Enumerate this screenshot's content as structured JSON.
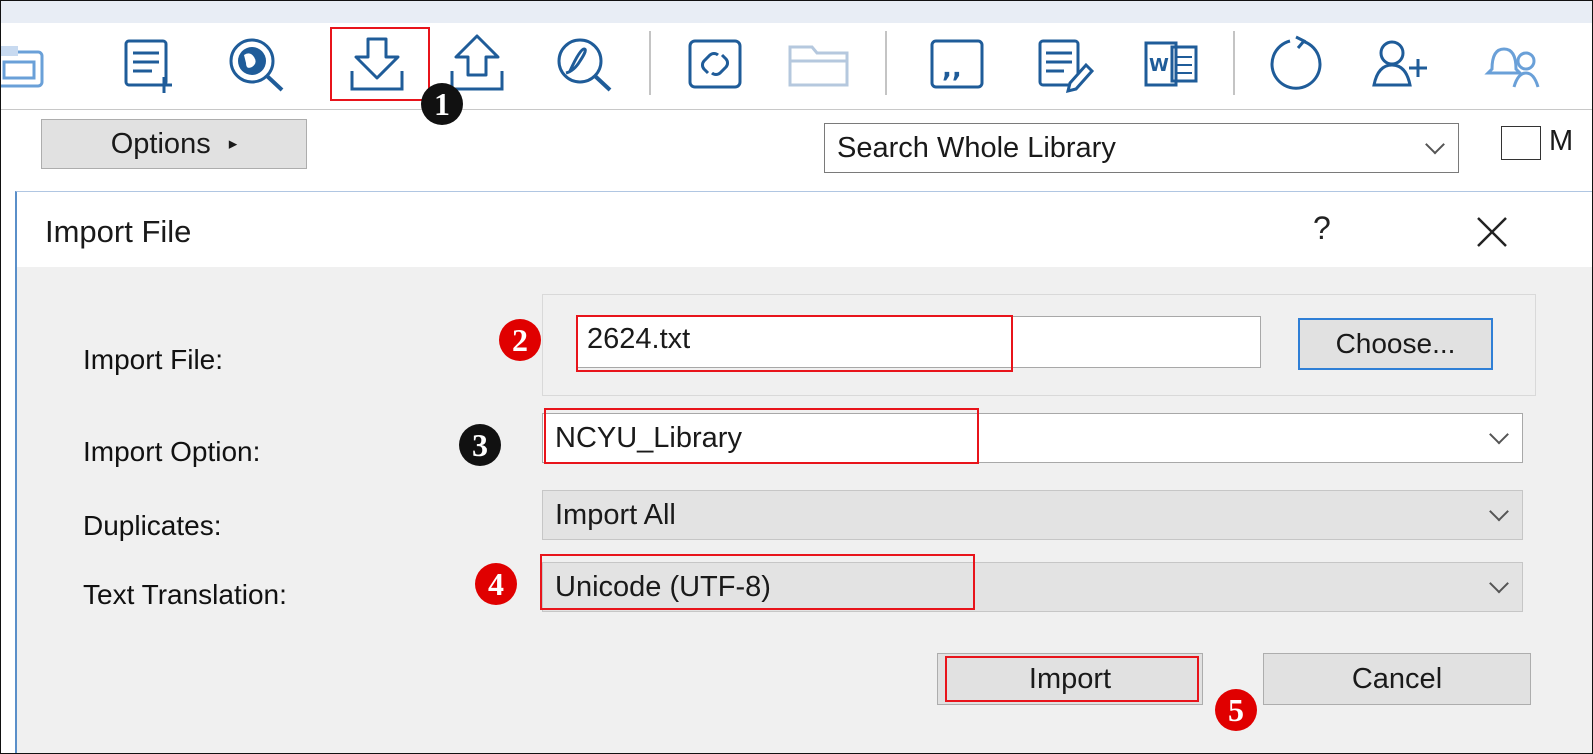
{
  "toolbar": {
    "icons": [
      "copy-to-library-icon",
      "new-reference-icon",
      "online-search-icon",
      "import-icon",
      "export-icon",
      "find-full-text-icon",
      "open-link-icon",
      "open-file-icon",
      "insert-citation-icon",
      "format-bibliography-icon",
      "return-to-word-icon",
      "sync-icon",
      "share-library-icon",
      "notifications-icon"
    ]
  },
  "search_bar": {
    "options_label": "Options",
    "options_arrow": "▸",
    "scope_value": "Search Whole Library",
    "match_label": "M"
  },
  "dialog": {
    "title": "Import File",
    "help": "?",
    "import_file_label": "Import File:",
    "import_file_value": "2624.txt",
    "choose_label": "Choose...",
    "import_option_label": "Import Option:",
    "import_option_value": "NCYU_Library",
    "duplicates_label": "Duplicates:",
    "duplicates_value": "Import All",
    "text_translation_label": "Text Translation:",
    "text_translation_value": "Unicode (UTF-8)",
    "import_button": "Import",
    "cancel_button": "Cancel"
  },
  "annotations": {
    "step1": "1",
    "step2": "2",
    "step3": "3",
    "step4": "4",
    "step5": "5",
    "highlight_color": "#e8141b"
  },
  "colors": {
    "accent": "#2f7fd6",
    "marker_red": "#e00000",
    "dialog_bg": "#f0f0f0"
  }
}
